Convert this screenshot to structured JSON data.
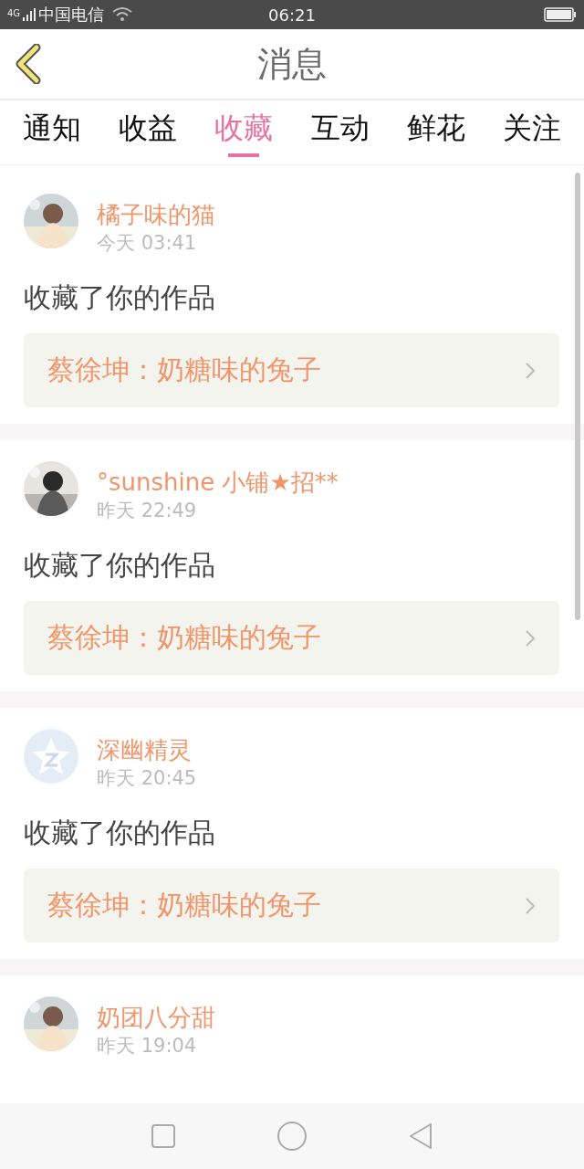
{
  "status_bar": {
    "network": "4G",
    "carrier": "中国电信",
    "time": "06:21"
  },
  "header": {
    "title": "消息"
  },
  "tabs": [
    {
      "label": "通知",
      "selected": false
    },
    {
      "label": "收益",
      "selected": false
    },
    {
      "label": "收藏",
      "selected": true
    },
    {
      "label": "互动",
      "selected": false
    },
    {
      "label": "鲜花",
      "selected": false
    },
    {
      "label": "关注",
      "selected": false
    }
  ],
  "messages": [
    {
      "user": "橘子味的猫",
      "time": "今天 03:41",
      "text": "收藏了你的作品",
      "work": "蔡徐坤：奶糖味的兔子"
    },
    {
      "user": "°sunshine 小铺★招**",
      "time": "昨天 22:49",
      "text": "收藏了你的作品",
      "work": "蔡徐坤：奶糖味的兔子"
    },
    {
      "user": "深幽精灵",
      "time": "昨天 20:45",
      "text": "收藏了你的作品",
      "work": "蔡徐坤：奶糖味的兔子",
      "avatar": {
        "kind": "default"
      }
    },
    {
      "user": "奶团八分甜",
      "time": "昨天 19:04"
    }
  ]
}
